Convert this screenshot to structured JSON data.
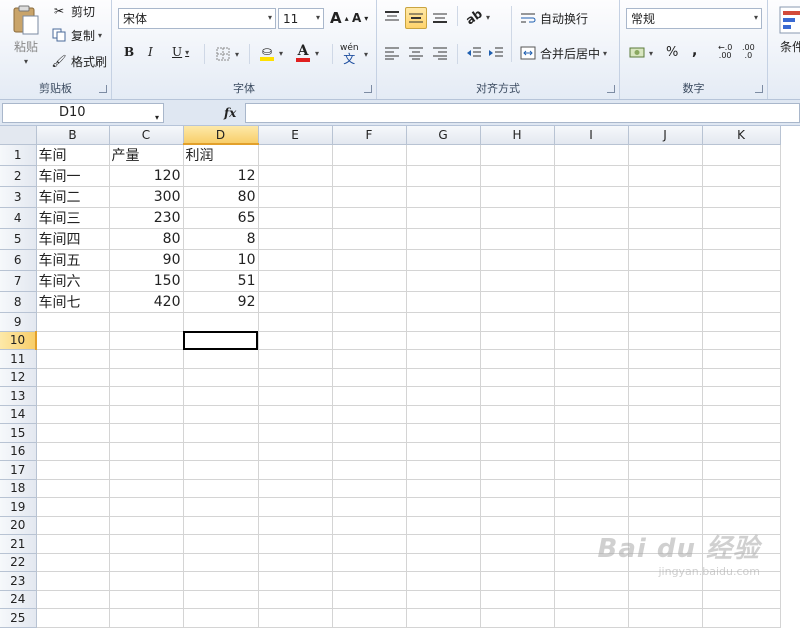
{
  "ribbon": {
    "clipboard": {
      "paste": "粘贴",
      "cut": "剪切",
      "copy": "复制",
      "format_painter": "格式刷",
      "label": "剪贴板"
    },
    "font": {
      "name": "宋体",
      "size": "11",
      "grow": "A",
      "shrink": "A",
      "bold": "B",
      "italic": "I",
      "underline": "U",
      "font_color_glyph": "A",
      "phonetic": "wén",
      "label": "字体",
      "font_color": "#e02020",
      "fill_color": "#ffe000"
    },
    "alignment": {
      "wrap_text": "自动换行",
      "merge_center": "合并后居中",
      "label": "对齐方式"
    },
    "number": {
      "format": "常规",
      "percent": "%",
      "comma": ",",
      "inc_decimal": ".00",
      "dec_decimal": ".0",
      "label": "数字"
    },
    "styles": {
      "conditional": "条件"
    }
  },
  "formula_bar": {
    "name_box": "D10",
    "fx": "fx",
    "value": ""
  },
  "grid": {
    "columns": [
      "B",
      "C",
      "D",
      "E",
      "F",
      "G",
      "H",
      "I",
      "J",
      "K"
    ],
    "selected_column": "D",
    "selected_row": 10,
    "rows": [
      {
        "n": "1",
        "cells": [
          "车间",
          "产量",
          "利润",
          "",
          "",
          "",
          "",
          "",
          "",
          ""
        ]
      },
      {
        "n": "2",
        "cells": [
          "车间一",
          "120",
          "12",
          "",
          "",
          "",
          "",
          "",
          "",
          ""
        ]
      },
      {
        "n": "3",
        "cells": [
          "车间二",
          "300",
          "80",
          "",
          "",
          "",
          "",
          "",
          "",
          ""
        ]
      },
      {
        "n": "4",
        "cells": [
          "车间三",
          "230",
          "65",
          "",
          "",
          "",
          "",
          "",
          "",
          ""
        ]
      },
      {
        "n": "5",
        "cells": [
          "车间四",
          "80",
          "8",
          "",
          "",
          "",
          "",
          "",
          "",
          ""
        ]
      },
      {
        "n": "6",
        "cells": [
          "车间五",
          "90",
          "10",
          "",
          "",
          "",
          "",
          "",
          "",
          ""
        ]
      },
      {
        "n": "7",
        "cells": [
          "车间六",
          "150",
          "51",
          "",
          "",
          "",
          "",
          "",
          "",
          ""
        ]
      },
      {
        "n": "8",
        "cells": [
          "车间七",
          "420",
          "92",
          "",
          "",
          "",
          "",
          "",
          "",
          ""
        ]
      },
      {
        "n": "9",
        "cells": [
          "",
          "",
          "",
          "",
          "",
          "",
          "",
          "",
          "",
          ""
        ]
      },
      {
        "n": "10",
        "cells": [
          "",
          "",
          "",
          "",
          "",
          "",
          "",
          "",
          "",
          ""
        ]
      },
      {
        "n": "11",
        "cells": [
          "",
          "",
          "",
          "",
          "",
          "",
          "",
          "",
          "",
          ""
        ]
      },
      {
        "n": "12",
        "cells": [
          "",
          "",
          "",
          "",
          "",
          "",
          "",
          "",
          "",
          ""
        ]
      },
      {
        "n": "13",
        "cells": [
          "",
          "",
          "",
          "",
          "",
          "",
          "",
          "",
          "",
          ""
        ]
      },
      {
        "n": "14",
        "cells": [
          "",
          "",
          "",
          "",
          "",
          "",
          "",
          "",
          "",
          ""
        ]
      },
      {
        "n": "15",
        "cells": [
          "",
          "",
          "",
          "",
          "",
          "",
          "",
          "",
          "",
          ""
        ]
      },
      {
        "n": "16",
        "cells": [
          "",
          "",
          "",
          "",
          "",
          "",
          "",
          "",
          "",
          ""
        ]
      },
      {
        "n": "17",
        "cells": [
          "",
          "",
          "",
          "",
          "",
          "",
          "",
          "",
          "",
          ""
        ]
      },
      {
        "n": "18",
        "cells": [
          "",
          "",
          "",
          "",
          "",
          "",
          "",
          "",
          "",
          ""
        ]
      },
      {
        "n": "19",
        "cells": [
          "",
          "",
          "",
          "",
          "",
          "",
          "",
          "",
          "",
          ""
        ]
      },
      {
        "n": "20",
        "cells": [
          "",
          "",
          "",
          "",
          "",
          "",
          "",
          "",
          "",
          ""
        ]
      },
      {
        "n": "21",
        "cells": [
          "",
          "",
          "",
          "",
          "",
          "",
          "",
          "",
          "",
          ""
        ]
      },
      {
        "n": "22",
        "cells": [
          "",
          "",
          "",
          "",
          "",
          "",
          "",
          "",
          "",
          ""
        ]
      },
      {
        "n": "23",
        "cells": [
          "",
          "",
          "",
          "",
          "",
          "",
          "",
          "",
          "",
          ""
        ]
      },
      {
        "n": "24",
        "cells": [
          "",
          "",
          "",
          "",
          "",
          "",
          "",
          "",
          "",
          ""
        ]
      },
      {
        "n": "25",
        "cells": [
          "",
          "",
          "",
          "",
          "",
          "",
          "",
          "",
          "",
          ""
        ]
      }
    ]
  },
  "watermark": {
    "logo": "Bai du 经验",
    "url": "jingyan.baidu.com"
  }
}
